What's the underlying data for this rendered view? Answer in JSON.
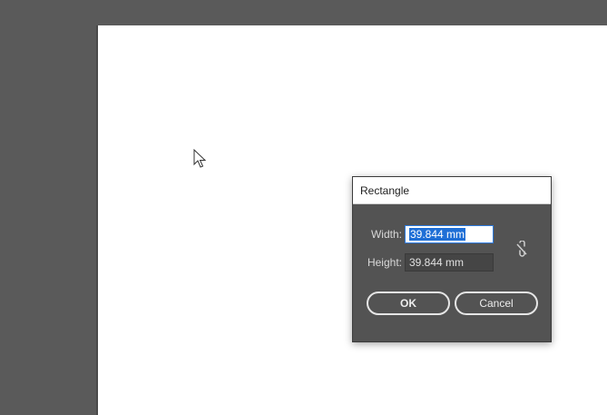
{
  "dialog": {
    "title": "Rectangle",
    "width_label": "Width:",
    "width_value": "39.844 mm",
    "height_label": "Height:",
    "height_value": "39.844 mm",
    "ok_label": "OK",
    "cancel_label": "Cancel"
  },
  "icons": {
    "constrain": "broken-link-icon",
    "cursor": "arrow-cursor-icon"
  },
  "colors": {
    "canvas_bg": "#5a5a5a",
    "artboard": "#ffffff",
    "dialog_bg": "#535353",
    "selection": "#1f6fd6"
  }
}
